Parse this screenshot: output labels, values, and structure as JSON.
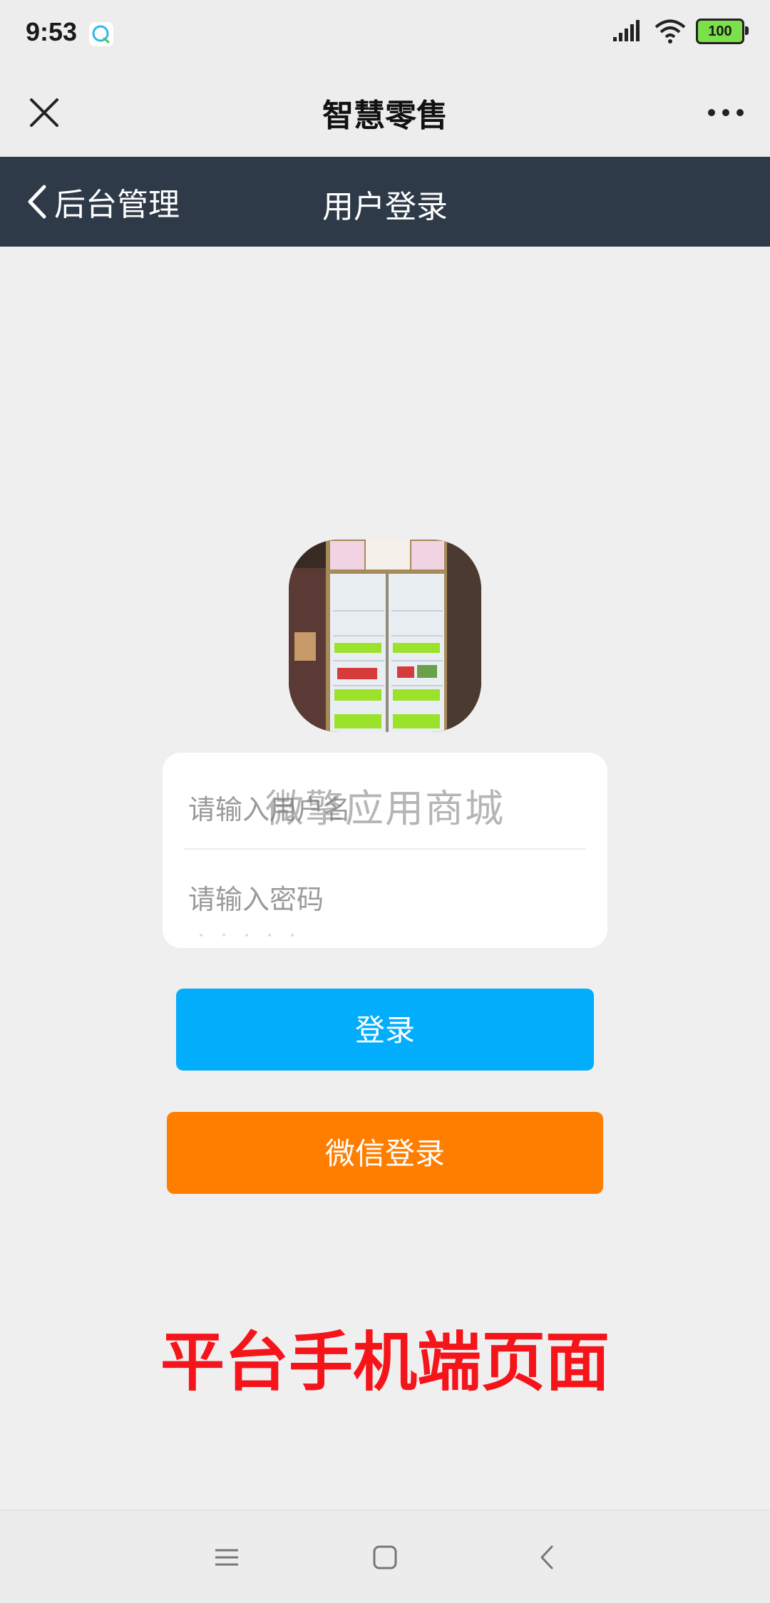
{
  "status_bar": {
    "time": "9:53",
    "battery": "100",
    "icons": [
      "chat-notification-icon",
      "signal-icon",
      "wifi-icon",
      "battery-icon"
    ]
  },
  "app_bar": {
    "title": "智慧零售",
    "close_icon": "close-icon",
    "more_icon": "more-icon"
  },
  "nav_bar": {
    "back_label": "后台管理",
    "title": "用户登录"
  },
  "logo": {
    "description_icon": "vending-fridge-image"
  },
  "form": {
    "username_placeholder": "请输入用户名",
    "password_placeholder": "请输入密码",
    "watermark": "微擎应用商城"
  },
  "buttons": {
    "login": "登录",
    "wechat_login": "微信登录"
  },
  "promo_text": "平台手机端页面",
  "system_nav": {
    "icons": [
      "menu-icon",
      "home-icon",
      "back-icon"
    ]
  },
  "colors": {
    "nav_bar": "#2f3a48",
    "login_button": "#02aefc",
    "wechat_button": "#ff7e00",
    "promo_text": "#f5141a",
    "background": "#efeff0"
  }
}
